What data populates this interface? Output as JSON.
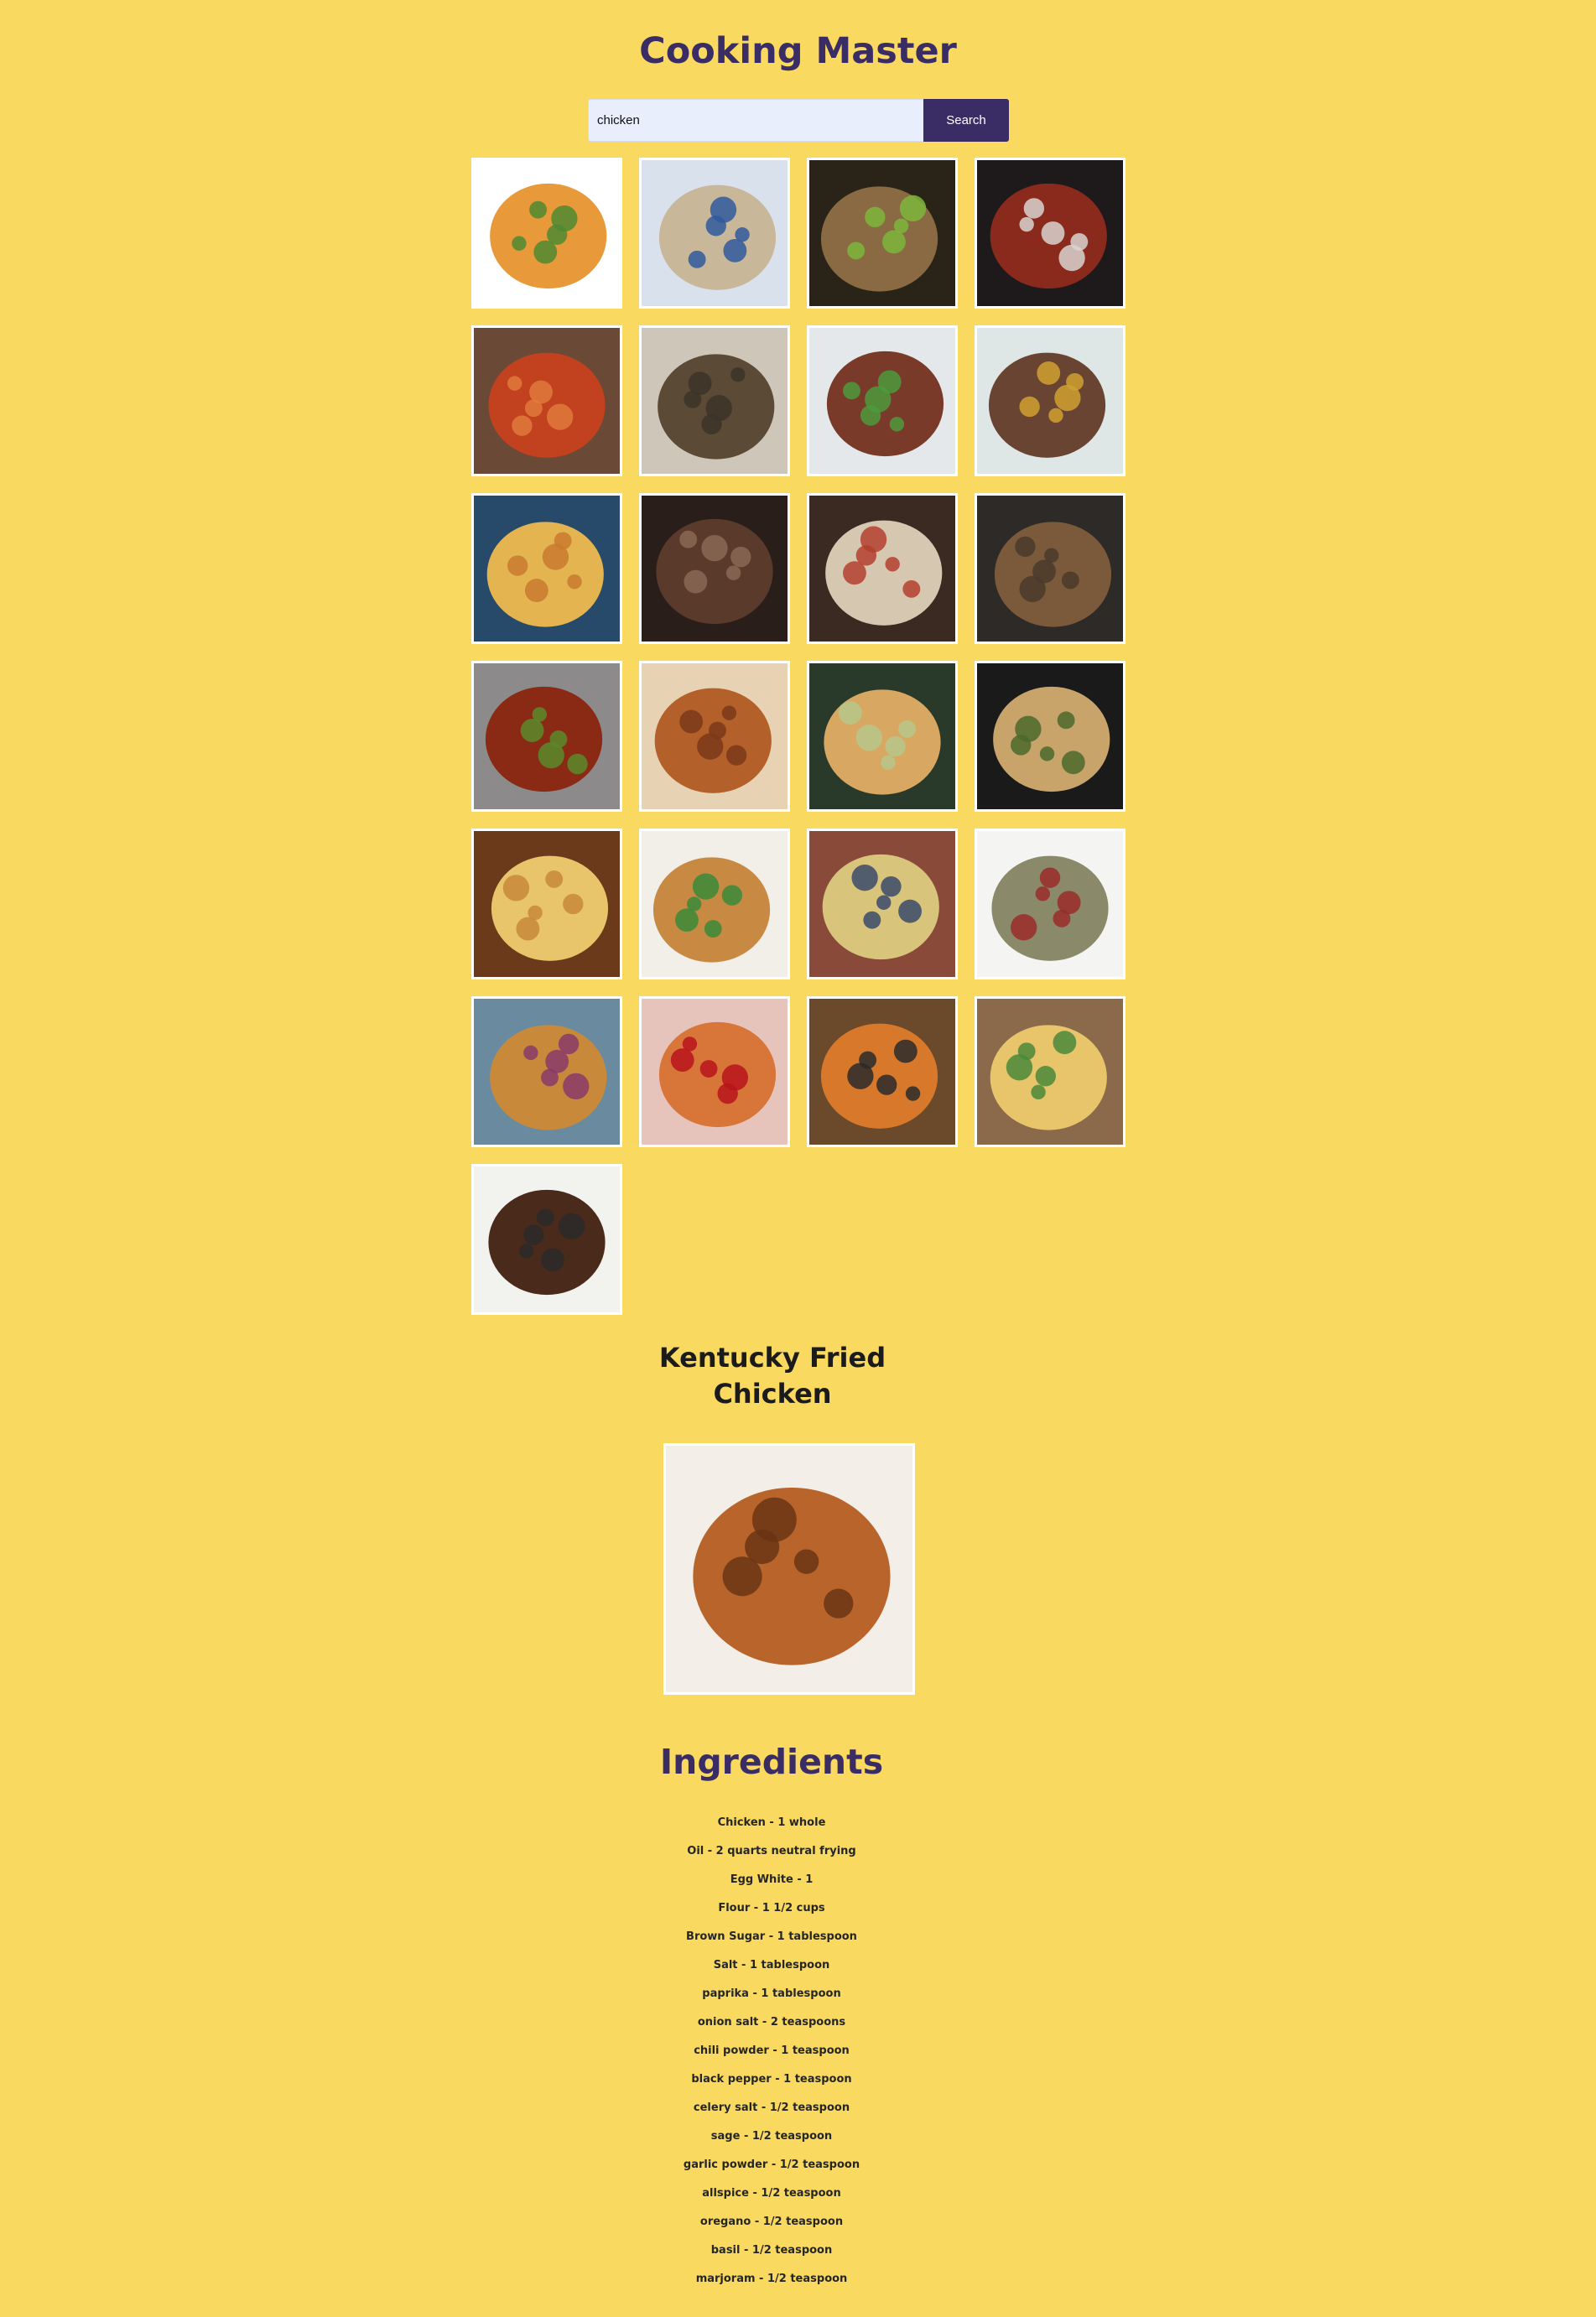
{
  "header": {
    "title": "Cooking Master"
  },
  "search": {
    "query": "chicken",
    "placeholder": "",
    "button_label": "Search"
  },
  "results": [
    {
      "photo": "orange chicken pieces on a floral plate",
      "colors": [
        "#ffffff",
        "#e89a3a",
        "#4e8a32"
      ]
    },
    {
      "photo": "chicken congee in a blue patterned bowl",
      "colors": [
        "#d9e2ec",
        "#c9b79a",
        "#2f5a9e"
      ]
    },
    {
      "photo": "grilled chicken with lettuce on a board",
      "colors": [
        "#2a2418",
        "#8a6a42",
        "#7db63c"
      ]
    },
    {
      "photo": "chicken stew in a white pot",
      "colors": [
        "#1e1a1c",
        "#8a2a1c",
        "#d9d4d0"
      ]
    },
    {
      "photo": "tandoori chicken legs",
      "colors": [
        "#6a4a36",
        "#c2411e",
        "#e07a3c"
      ]
    },
    {
      "photo": "chicken rice pilaf in a white bowl",
      "colors": [
        "#cfc6ba",
        "#5a4a36",
        "#3c3428"
      ]
    },
    {
      "photo": "chicken stir fry with vegetables",
      "colors": [
        "#e4e8ea",
        "#7a3a2a",
        "#4c9a3c"
      ]
    },
    {
      "photo": "chicken with peppers in a cast iron pan",
      "colors": [
        "#dfe6e6",
        "#6a4432",
        "#d0a030"
      ]
    },
    {
      "photo": "chicken curry with flatbread",
      "colors": [
        "#274a6a",
        "#e3b450",
        "#c97a2e"
      ]
    },
    {
      "photo": "braised dark chicken",
      "colors": [
        "#2a1e1a",
        "#5a3a2a",
        "#8a6a56"
      ]
    },
    {
      "photo": "chicken with rice in a bowl and chopsticks",
      "colors": [
        "#3a2a22",
        "#d6c7b0",
        "#b3402e"
      ]
    },
    {
      "photo": "roast chicken in a dark pan",
      "colors": [
        "#2e2a28",
        "#7a5a3a",
        "#4a3a2c"
      ]
    },
    {
      "photo": "glazed chicken with sesame over rice",
      "colors": [
        "#8c8a8a",
        "#8a2a14",
        "#5a8a2a"
      ]
    },
    {
      "photo": "fried chicken pieces",
      "colors": [
        "#e8d2b4",
        "#b4602a",
        "#7a3a1a"
      ]
    },
    {
      "photo": "chicken pot pie in a dish",
      "colors": [
        "#2a3a2a",
        "#d8a862",
        "#b6c78a"
      ]
    },
    {
      "photo": "chicken pasta in a skillet",
      "colors": [
        "#1a1a1a",
        "#c9a46a",
        "#4a6a2a"
      ]
    },
    {
      "photo": "chicken and potato bake",
      "colors": [
        "#6a3a1a",
        "#e8c46a",
        "#c88a3a"
      ]
    },
    {
      "photo": "chicken fried rice with vegetables",
      "colors": [
        "#f2efe9",
        "#c88a42",
        "#3a8a3a"
      ]
    },
    {
      "photo": "chicken and vegetable gratin",
      "colors": [
        "#8a4a3a",
        "#d8c47a",
        "#3a4a6a"
      ]
    },
    {
      "photo": "chicken salad with pomegranate",
      "colors": [
        "#f4f4f2",
        "#8a8a6a",
        "#9a2a2a"
      ]
    },
    {
      "photo": "grilled chicken with sweet potato and slaw",
      "colors": [
        "#6a8aa0",
        "#c88a3a",
        "#8a3a6a"
      ]
    },
    {
      "photo": "chicken pasta bake in a red dish",
      "colors": [
        "#e6c4bc",
        "#d8763a",
        "#b8141c"
      ]
    },
    {
      "photo": "spicy chicken pasta on a patterned plate",
      "colors": [
        "#6a4a2a",
        "#d8782a",
        "#2a2a2a"
      ]
    },
    {
      "photo": "chicken enchiladas in a glass dish",
      "colors": [
        "#8a6a4a",
        "#e8c46a",
        "#4a8a3a"
      ]
    },
    {
      "photo": "jerk chicken with rice and salsa",
      "colors": [
        "#f2f2ee",
        "#4a2a1a",
        "#2a2a2a"
      ]
    }
  ],
  "selected_meal": {
    "title": "Kentucky Fried Chicken",
    "photo": "fried chicken pieces on paper",
    "colors": [
      "#f3efe8",
      "#b8642a",
      "#6a3414"
    ]
  },
  "ingredients": {
    "heading": "Ingredients",
    "items": [
      "Chicken - 1 whole",
      "Oil - 2 quarts neutral frying",
      "Egg White - 1",
      "Flour - 1 1/2 cups",
      "Brown Sugar - 1 tablespoon",
      "Salt - 1 tablespoon",
      "paprika - 1 tablespoon",
      "onion salt - 2 teaspoons",
      "chili powder - 1 teaspoon",
      "black pepper - 1 teaspoon",
      "celery salt - 1/2 teaspoon",
      "sage - 1/2 teaspoon",
      "garlic powder - 1/2 teaspoon",
      "allspice - 1/2 teaspoon",
      "oregano - 1/2 teaspoon",
      "basil - 1/2 teaspoon",
      "marjoram - 1/2 teaspoon"
    ]
  }
}
